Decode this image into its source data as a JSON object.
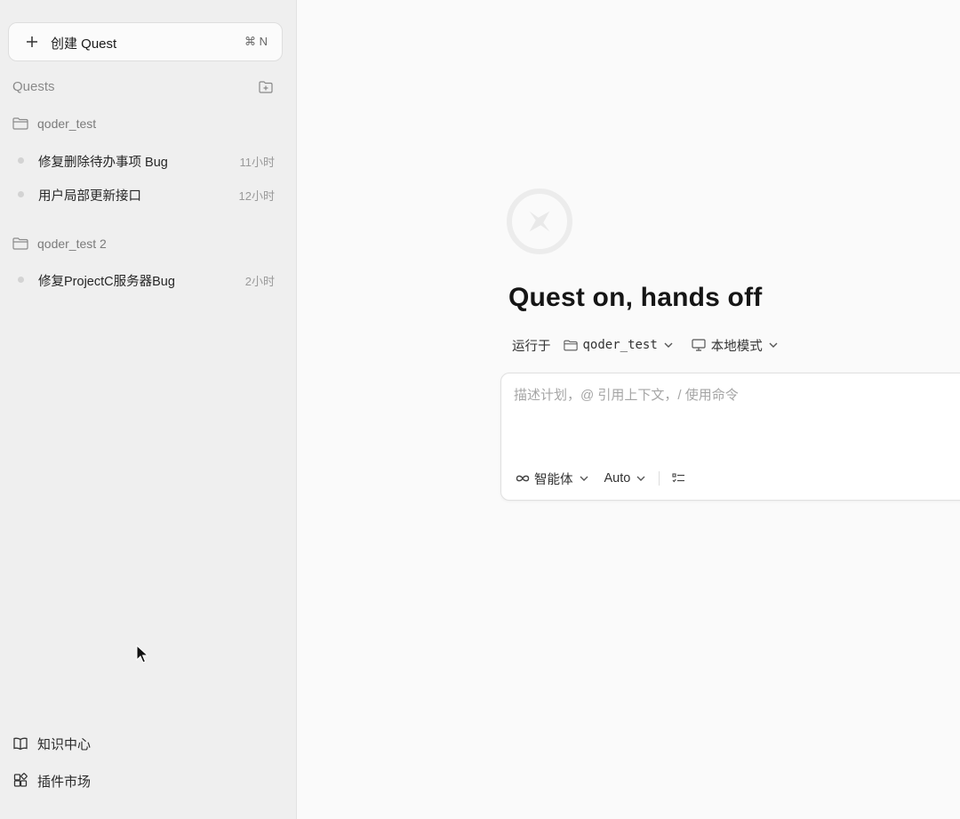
{
  "sidebar": {
    "create_button": {
      "icon": "plus-icon",
      "label": "创建 Quest",
      "shortcut": "⌘ N"
    },
    "quests_header": "Quests",
    "groups": [
      {
        "name": "qoder_test",
        "items": [
          {
            "title": "修复删除待办事项 Bug",
            "time": "11小时"
          },
          {
            "title": "用户局部更新接口",
            "time": "12小时"
          }
        ]
      },
      {
        "name": "qoder_test 2",
        "items": [
          {
            "title": "修复ProjectC服务器Bug",
            "time": "2小时"
          }
        ]
      }
    ],
    "bottom": [
      {
        "label": "知识中心",
        "icon": "book-icon"
      },
      {
        "label": "插件市场",
        "icon": "plugin-grid-icon"
      }
    ]
  },
  "main": {
    "headline": "Quest on, hands off",
    "run_prefix": "运行于",
    "workspace": "qoder_test",
    "mode": "本地模式",
    "prompt_placeholder": "描述计划，@ 引用上下文，/ 使用命令",
    "toolbar": {
      "agent_label": "智能体",
      "model_label": "Auto"
    }
  },
  "colors": {
    "sidebar_bg": "#efefef",
    "main_bg": "#fafafa",
    "text_primary": "#1f1f1f",
    "text_muted": "#8a8a8a"
  }
}
